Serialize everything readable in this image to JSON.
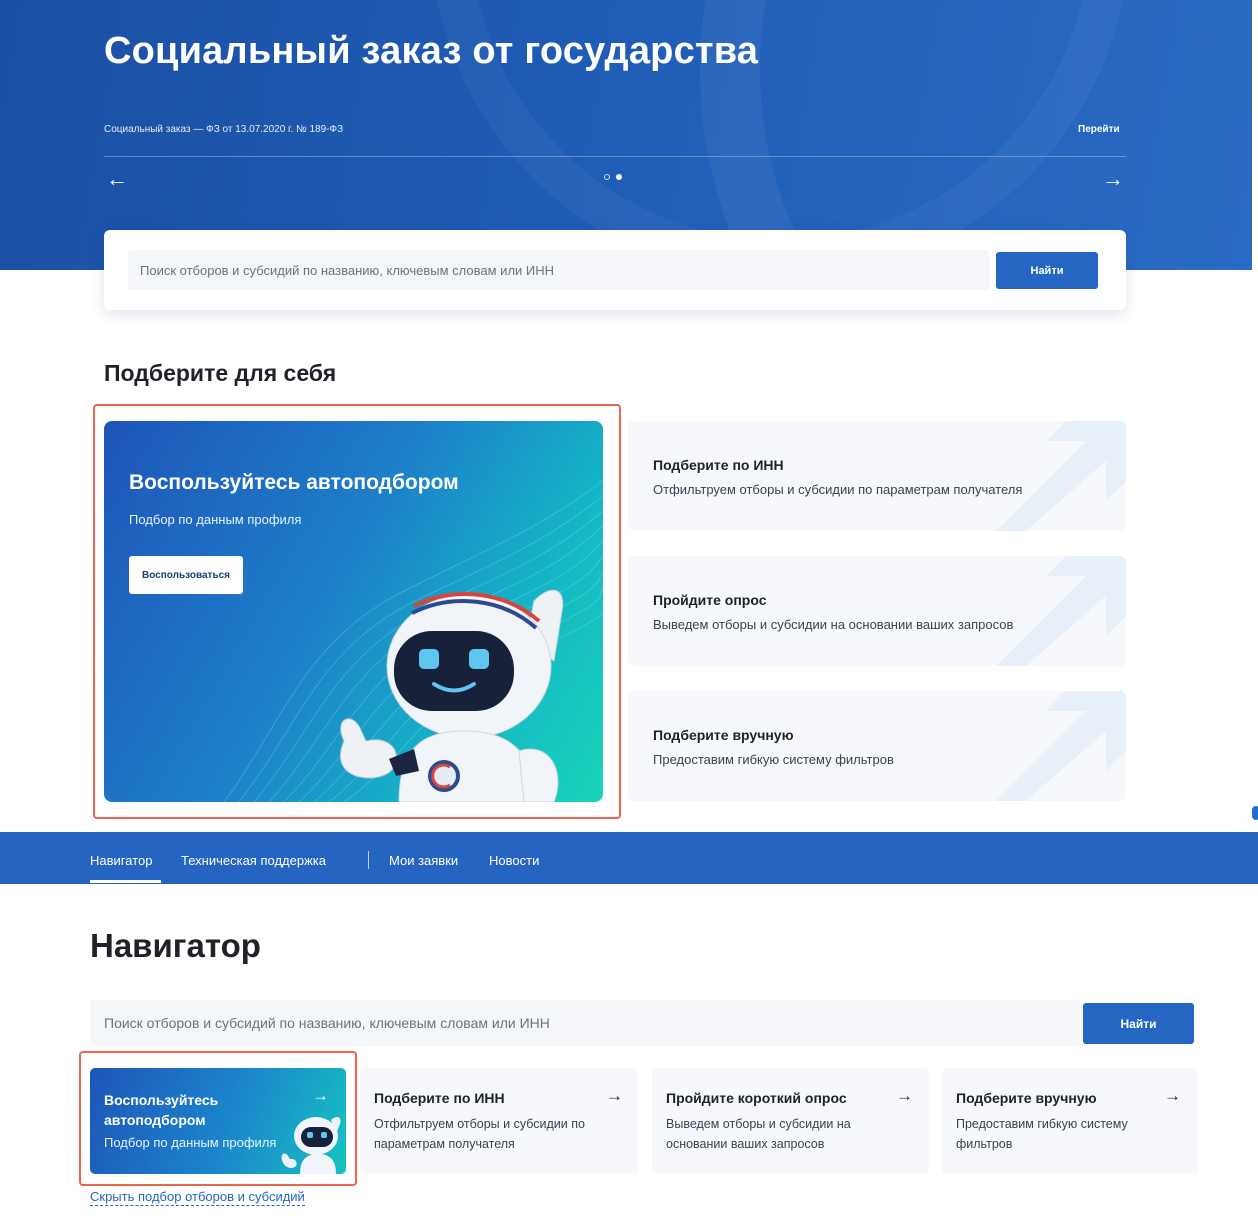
{
  "hero": {
    "title": "Социальный заказ от государства",
    "subtitle": "Социальный заказ — ФЗ от 13.07.2020 г. № 189-ФЗ",
    "link": "Перейти",
    "prev_arrow": "←",
    "next_arrow": "→",
    "slides_total": 2,
    "slide_active": 2
  },
  "top_search": {
    "placeholder": "Поиск отборов и субсидий по названию, ключевым словам или ИНН",
    "button": "Найти"
  },
  "pick_section": {
    "title": "Подберите для себя",
    "promo": {
      "title": "Воспользуйтесь автоподбором",
      "subtitle": "Подбор по данным профиля",
      "button": "Воспользоваться"
    },
    "options": [
      {
        "title": "Подберите по ИНН",
        "description": "Отфильтруем отборы и субсидии по параметрам получателя"
      },
      {
        "title": "Пройдите опрос",
        "description": "Выведем отборы и субсидии на основании ваших запросов"
      },
      {
        "title": "Подберите вручную",
        "description": "Предоставим гибкую систему фильтров"
      }
    ]
  },
  "navbar": {
    "items": [
      "Навигатор",
      "Техническая поддержка",
      "Мои заявки",
      "Новости"
    ],
    "active": "Навигатор"
  },
  "navigator": {
    "title": "Навигатор",
    "search": {
      "placeholder": "Поиск отборов и субсидий по названию, ключевым словам или ИНН",
      "button": "Найти"
    },
    "promo": {
      "title": "Воспользуйтесь автоподбором",
      "subtitle": "Подбор по данным профиля",
      "arrow": "→"
    },
    "cards": [
      {
        "title": "Подберите по ИНН",
        "description": "Отфильтруем отборы и субсидии по параметрам получателя",
        "arrow": "→"
      },
      {
        "title": "Пройдите короткий опрос",
        "description": "Выведем отборы и субсидии на основании ваших запросов",
        "arrow": "→"
      },
      {
        "title": "Подберите вручную",
        "description": "Предоставим гибкую систему фильтров",
        "arrow": "→"
      }
    ],
    "hide_link": "Скрыть подбор отборов и субсидий"
  },
  "colors": {
    "brand_blue": "#2566c2",
    "hero_blue": "#1f5cb5",
    "highlight": "#e8664f",
    "teal": "#16c2c0"
  },
  "icons": [
    "arrow-left-icon",
    "arrow-right-icon",
    "robot-mascot-icon",
    "diagonal-arrow-decor-icon"
  ]
}
